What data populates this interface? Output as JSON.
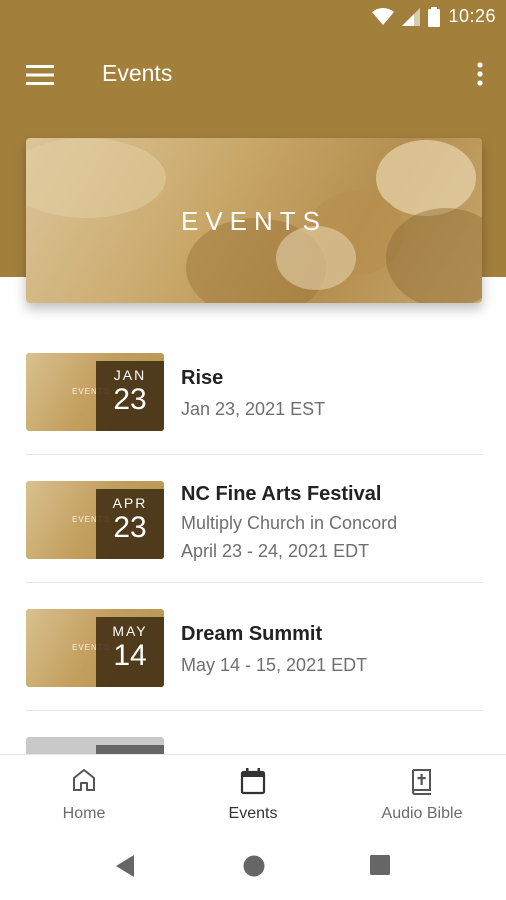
{
  "status_bar": {
    "time": "10:26"
  },
  "app_bar": {
    "title": "Events"
  },
  "hero": {
    "label": "EVENTS"
  },
  "events": [
    {
      "thumb_word": "EVENTS",
      "month": "JAN",
      "day": "23",
      "title": "Rise",
      "line1": "Jan 23, 2021 EST",
      "line2": ""
    },
    {
      "thumb_word": "EVENTS",
      "month": "APR",
      "day": "23",
      "title": "NC Fine Arts Festival",
      "line1": "Multiply Church in Concord",
      "line2": "April 23 - 24, 2021 EDT"
    },
    {
      "thumb_word": "EVENTS",
      "month": "MAY",
      "day": "14",
      "title": "Dream Summit",
      "line1": "May 14 - 15, 2021 EDT",
      "line2": ""
    }
  ],
  "bottom_nav": [
    {
      "label": "Home",
      "icon": "home-icon"
    },
    {
      "label": "Events",
      "icon": "calendar-icon"
    },
    {
      "label": "Audio Bible",
      "icon": "bible-icon"
    }
  ],
  "colors": {
    "brand": "#a37f3c",
    "date_box": "#3c2a10"
  }
}
